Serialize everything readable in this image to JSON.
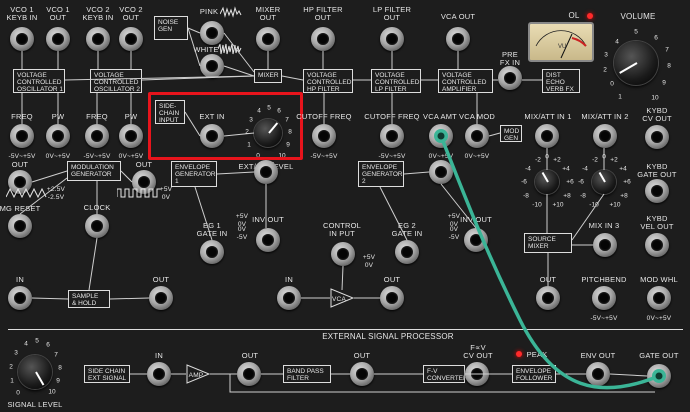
{
  "labels": {
    "vco1_keybin": "VCO 1\nKEYB IN",
    "vco1_out": "VCO 1\nOUT",
    "vco2_keybin": "VCO 2\nKEYB IN",
    "vco2_out": "VCO 2\nOUT",
    "noise_gen": "NOISE\nGEN",
    "pink": "PINK",
    "white": "WHITE",
    "mixer_out": "MIXER\nOUT",
    "hp_filter_out": "HP FILTER\nOUT",
    "lp_filter_out": "LP FILTER\nOUT",
    "vca_out": "VCA OUT",
    "ol": "OL",
    "volume": "VOLUME",
    "vco1_box": "VOLTAGE\nCONTROLLED\nOSCILLATOR 1",
    "vco2_box": "VOLTAGE\nCONTROLLED\nOSCILLATOR 2",
    "mixer_box": "MIXER",
    "hp_box": "VOLTAGE\nCONTROLLED\nHP FILTER",
    "lp_box": "VOLTAGE\nCONTROLLED\nLP FILTER",
    "vca_box": "VOLTAGE\nCONTROLLED\nAMPLIFIER",
    "pre_fx_in": "PRE\nFX IN",
    "dist_box": "DIST\nECHO\nVERB FX",
    "freq1": "FREQ",
    "pw1": "PW",
    "freq2": "FREQ",
    "pw2": "PW",
    "range_freq": "-5V~+5V",
    "range_pw": "0V~+5V",
    "side_chain_input": "SIDE-\nCHAIN\nINPUT",
    "ext_in": "EXT IN",
    "ext_sc_level": "EXT/SC LEVEL",
    "cutoff1": "CUTOFF FREQ",
    "cutoff2": "CUTOFF FREQ",
    "vca_amt": "VCA AMT",
    "vca_mod": "VCA MOD",
    "mod_gen": "MOD\nGEN",
    "mixatt1": "MIX/ATT IN 1",
    "mixatt2": "MIX/ATT IN 2",
    "kybd_cv": "KYBD\nCV OUT",
    "out_a": "OUT",
    "out_b": "OUT",
    "mod_gen_box": "MODULATION\nGENERATOR",
    "env_gen1_box": "ENVELOPE\nGENERATOR\n1",
    "env_gen2_box": "ENVELOPE\nGENERATOR\n2",
    "kybd_gate": "KYBD\nGATE OUT",
    "mg_reset": "MG RESET",
    "clock": "CLOCK",
    "eg1_gate": "EG 1\nGATE IN",
    "inv_out1": "INV OUT",
    "control_in": "CONTROL\nIN PUT",
    "eg2_gate": "EG 2\nGATE IN",
    "inv_out2": "INV OUT",
    "mix_in3": "MIX IN 3",
    "kybd_vel": "KYBD\nVEL OUT",
    "source_mixer": "SOURCE\nMIXER",
    "in_a": "IN",
    "sample_hold": "SAMPLE\n& HOLD",
    "out_sh": "OUT",
    "in_vca": "IN",
    "out_vca": "OUT",
    "vca_small": "VCA",
    "out_mix": "OUT",
    "pitchbend": "PITCHBEND",
    "mod_whl": "MOD WHL",
    "range_pb": "-5V~+5V",
    "range_mw": "0V~+5V",
    "mg_range": "+2.5V\n-2.5V",
    "clk_range": "+5V\n0V",
    "eg1_range": "+5V\n0V",
    "eg1_range2": "0V\n-5V",
    "eg2_range": "+5V\n0V",
    "eg2_range2": "0V\n-5V",
    "ctrl_range": "+5V\n0V",
    "esp_title": "EXTERNAL SIGNAL PROCESSOR",
    "signal_level": "SIGNAL LEVEL",
    "side_chain_ext": "SIDE CHAIN\nEXT SIGNAL",
    "esp_in": "IN",
    "amp": "AMP",
    "esp_out1": "OUT",
    "band_pass": "BAND PASS\nFILTER",
    "esp_out2": "OUT",
    "fv_conv": "F-V\nCONVERTER",
    "fv_cv": "F∝V\nCV OUT",
    "peak": "PEAK",
    "env_follower": "ENVELOPE\nFOLLOWER",
    "env_out": "ENV OUT",
    "gate_out": "GATE OUT",
    "vu_vu": "VU"
  },
  "knob_scales": {
    "ext_sc": [
      "0",
      "1",
      "2",
      "3",
      "4",
      "5",
      "6",
      "7",
      "8",
      "9",
      "10"
    ],
    "volume": [
      "0",
      "1",
      "2",
      "3",
      "4",
      "5",
      "6",
      "7",
      "8",
      "9",
      "10"
    ],
    "signal_level": [
      "0",
      "1",
      "2",
      "3",
      "4",
      "5",
      "6",
      "7",
      "8",
      "9",
      "10"
    ],
    "mixatt": [
      "-10",
      "-8",
      "-6",
      "-4",
      "-2",
      "0",
      "+2",
      "+4",
      "+6",
      "+8",
      "+10"
    ]
  },
  "colors": {
    "patch_cable": "#3bb597",
    "highlight": "#e8141c",
    "led": "#ff2a2a"
  },
  "patch": {
    "from": "vca-amt-jack",
    "to": "gate-out-jack"
  }
}
